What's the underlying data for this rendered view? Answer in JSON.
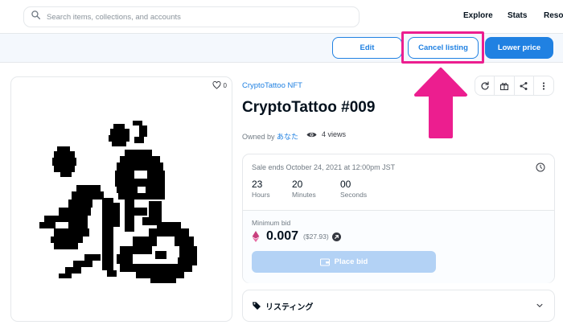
{
  "header": {
    "search_placeholder": "Search items, collections, and accounts",
    "nav": {
      "explore": "Explore",
      "stats": "Stats",
      "resources": "Resources"
    }
  },
  "actions": {
    "edit": "Edit",
    "cancel_listing": "Cancel listing",
    "lower_price": "Lower price"
  },
  "item": {
    "like_count": "0",
    "collection": "CryptoTattoo NFT",
    "title": "CryptoTattoo #009",
    "owned_by": "Owned by ",
    "owner": "あなた",
    "views": "4 views"
  },
  "sale": {
    "ends": "Sale ends October 24, 2021 at 12:00pm JST",
    "countdown": [
      {
        "value": "23",
        "label": "Hours"
      },
      {
        "value": "20",
        "label": "Minutes"
      },
      {
        "value": "00",
        "label": "Seconds"
      }
    ],
    "minimum_bid_label": "Minimum bid",
    "price": "0.007",
    "usd": "($27.93)",
    "place_bid": "Place bid"
  },
  "listing": {
    "label": "リスティング"
  },
  "colors": {
    "accent": "#2081e2",
    "highlight": "#ec1e8f",
    "disabled_button": "#b3d2f5"
  }
}
